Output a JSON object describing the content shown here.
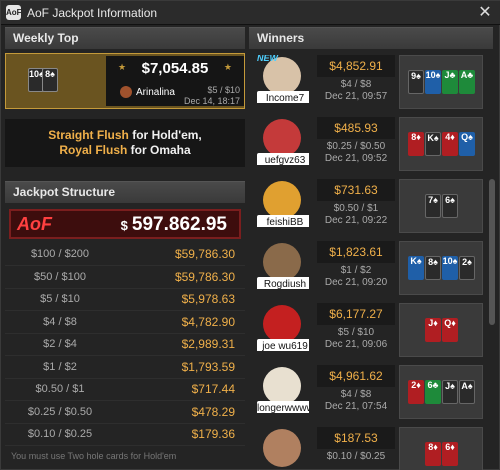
{
  "window": {
    "title": "AoF Jackpot Information",
    "app_icon": "AoF"
  },
  "weekly_top": {
    "header": "Weekly Top",
    "cards": [
      "10♠",
      "8♠"
    ],
    "amount": "$7,054.85",
    "stake": "$5 / $10",
    "player": "Arinalina",
    "date": "Dec 14, 18:17",
    "rule_line1_a": "Straight Flush",
    "rule_line1_b": "for Hold'em,",
    "rule_line2_a": "Royal Flush",
    "rule_line2_b": "for Omaha"
  },
  "jackpot_structure": {
    "header": "Jackpot Structure",
    "logo": "AoF",
    "dollar": "$",
    "total": "597.862.95",
    "rows": [
      {
        "stake": "$100 / $200",
        "amount": "$59,786.30"
      },
      {
        "stake": "$50 / $100",
        "amount": "$59,786.30"
      },
      {
        "stake": "$5 / $10",
        "amount": "$5,978.63"
      },
      {
        "stake": "$4 / $8",
        "amount": "$4,782.90"
      },
      {
        "stake": "$2 / $4",
        "amount": "$2,989.31"
      },
      {
        "stake": "$1 / $2",
        "amount": "$1,793.59"
      },
      {
        "stake": "$0.50 / $1",
        "amount": "$717.44"
      },
      {
        "stake": "$0.25 / $0.50",
        "amount": "$478.29"
      },
      {
        "stake": "$0.10 / $0.25",
        "amount": "$179.36"
      }
    ],
    "footnote": "You must use Two hole cards for Hold'em"
  },
  "winners": {
    "header": "Winners",
    "new_label": "NEW",
    "rows": [
      {
        "name": "Income7",
        "amount": "$4,852.91",
        "stake": "$4 / $8",
        "date": "Dec 21, 09:57",
        "avatar_color": "#d8c2a8",
        "cards": [
          {
            "t": "9♠",
            "c": "black"
          },
          {
            "t": "10♠",
            "c": "blue"
          },
          {
            "t": "J♣",
            "c": "green"
          },
          {
            "t": "A♣",
            "c": "green"
          }
        ]
      },
      {
        "name": "uefgvz63",
        "amount": "$485.93",
        "stake": "$0.25 / $0.50",
        "date": "Dec 21, 09:52",
        "avatar_color": "#c43a3a",
        "cards": [
          {
            "t": "8♦",
            "c": "red"
          },
          {
            "t": "K♠",
            "c": "black"
          },
          {
            "t": "4♦",
            "c": "red"
          },
          {
            "t": "Q♠",
            "c": "blue"
          }
        ]
      },
      {
        "name": "feishiBB",
        "amount": "$731.63",
        "stake": "$0.50 / $1",
        "date": "Dec 21, 09:22",
        "avatar_color": "#e0a030",
        "cards": [
          {
            "t": "7♠",
            "c": "black"
          },
          {
            "t": "6♠",
            "c": "black"
          }
        ]
      },
      {
        "name": "Rogdiush",
        "amount": "$1,823.61",
        "stake": "$1 / $2",
        "date": "Dec 21, 09:20",
        "avatar_color": "#8a6a4a",
        "cards": [
          {
            "t": "K♠",
            "c": "blue"
          },
          {
            "t": "8♠",
            "c": "black"
          },
          {
            "t": "10♠",
            "c": "blue"
          },
          {
            "t": "2♠",
            "c": "black"
          }
        ]
      },
      {
        "name": "joe wu619",
        "amount": "$6,177.27",
        "stake": "$5 / $10",
        "date": "Dec 21, 09:06",
        "avatar_color": "#c42020",
        "cards": [
          {
            "t": "J♦",
            "c": "red"
          },
          {
            "t": "Q♦",
            "c": "red"
          }
        ]
      },
      {
        "name": "longerwwww",
        "amount": "$4,961.62",
        "stake": "$4 / $8",
        "date": "Dec 21, 07:54",
        "avatar_color": "#e8e0d0",
        "cards": [
          {
            "t": "2♦",
            "c": "red"
          },
          {
            "t": "6♣",
            "c": "green"
          },
          {
            "t": "J♠",
            "c": "black"
          },
          {
            "t": "A♠",
            "c": "black"
          }
        ]
      },
      {
        "name": "",
        "amount": "$187.53",
        "stake": "$0.10 / $0.25",
        "date": "",
        "avatar_color": "#b08060",
        "cards": [
          {
            "t": "8♦",
            "c": "red"
          },
          {
            "t": "6♦",
            "c": "red"
          }
        ]
      }
    ]
  },
  "colors": {
    "accent_gold": "#f0b04a",
    "card_red": "#b01e22",
    "card_blue": "#1f5fa8",
    "card_green": "#1e8a3a"
  }
}
